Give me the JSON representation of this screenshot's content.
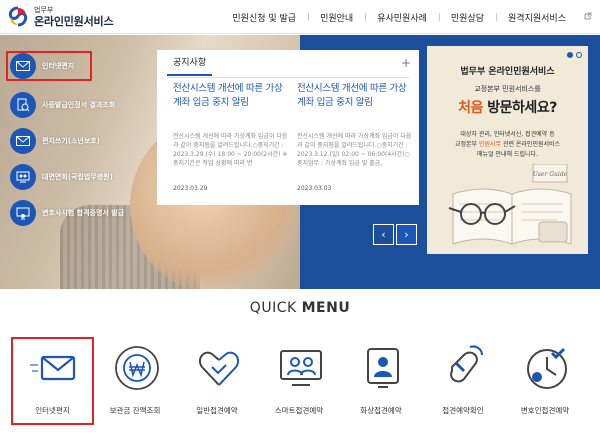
{
  "header": {
    "logo_sub": "법무부",
    "logo_main": "온라인민원서비스",
    "nav": [
      "민원신청 및 발급",
      "민원안내",
      "유사민원사례",
      "민원상담",
      "원격지원서비스"
    ]
  },
  "side_menu": [
    {
      "label": "인터넷편지",
      "icon": "envelope-icon"
    },
    {
      "label": "사증발급인정서 결과조회",
      "icon": "passport-search-icon"
    },
    {
      "label": "편지쓰기(소년보호)",
      "icon": "envelope-icon"
    },
    {
      "label": "대면면회(국립법무병원)",
      "icon": "visit-icon"
    },
    {
      "label": "변호사시험 합격증명서 발급",
      "icon": "certificate-icon"
    }
  ],
  "notice": {
    "tab": "공지사항",
    "more": "+",
    "items": [
      {
        "title": "전산시스템 개선에 따른 가상계좌 입금 중지 알림",
        "body": "전산시스템 개선에 따라 가상계좌 입금이 다음과 같이 중지됨을 알려드립니다.○중지기간 : 2023.3.29.(수) 18:00 ~ 20:00(2시간) ※ 중지기간은 작업 상황에 따라 변",
        "date": "2023.03.29"
      },
      {
        "title": "전산시스템 개선에 따른 가상계좌 입금 중지 알림",
        "body": "전산시스템 개선에 따라 가상계좌 입금이 다음과 같이 중지됨을 알려드립니다.○중지기간 : 2023.3.12.(일) 02:00 ~ 06:00(4시간)○중지업무 : 가상계좌 입금 및 출금,",
        "date": "2023.03.03"
      }
    ],
    "prev": "‹",
    "next": "›"
  },
  "banner": {
    "title": "법무부 온라인민원서비스",
    "sub": "교정본부 민원서비스를",
    "big_hl": "처음",
    "big_rest": " 방문하세요?",
    "desc_line1": "대상자 관리, 인터넷서신, 접견예약 등",
    "desc_line2_a": "교정본부 ",
    "desc_line2_hl": "민원사무",
    "desc_line2_b": " 관련 온라인민원서비스",
    "desc_line3": "매뉴얼 안내해 드립니다.",
    "book_label": "User Guide"
  },
  "quick_menu": {
    "title_light": "QUICK ",
    "title_bold": "MENU",
    "items": [
      {
        "label": "인터넷편지",
        "icon": "envelope-icon"
      },
      {
        "label": "보관금 잔액조회",
        "icon": "won-coin-icon"
      },
      {
        "label": "일반접견예약",
        "icon": "heart-hands-icon"
      },
      {
        "label": "스마트접견예약",
        "icon": "video-call-icon"
      },
      {
        "label": "화상접견예약",
        "icon": "monitor-person-icon"
      },
      {
        "label": "접견예약확인",
        "icon": "mouse-click-icon"
      },
      {
        "label": "변호인접견예약",
        "icon": "clock-check-icon"
      }
    ]
  },
  "colors": {
    "brand_blue": "#1c57b7",
    "highlight_red": "#e32222",
    "accent_orange": "#e0571b"
  }
}
